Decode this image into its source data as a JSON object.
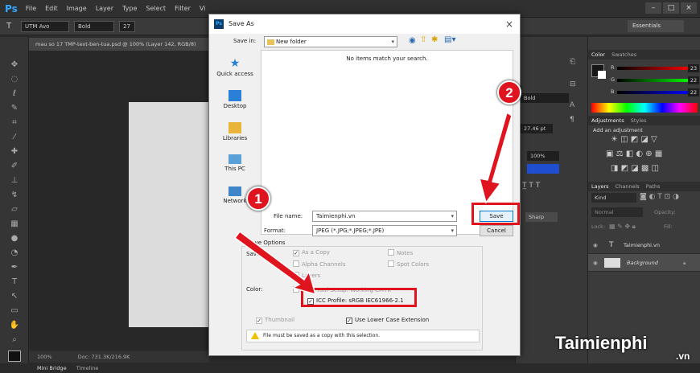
{
  "app": {
    "logo": "Ps",
    "menu": [
      "File",
      "Edit",
      "Image",
      "Layer",
      "Type",
      "Select",
      "Filter",
      "Vi"
    ]
  },
  "window_buttons": [
    "–",
    "□",
    "×"
  ],
  "options_bar": {
    "font_family": "UTM Avo",
    "font_style": "Bold",
    "size_prefix": "27"
  },
  "workspace": "Essentials",
  "document_tab": "mau so 17 TMP-text-ben-tua.psd @ 100% (Layer 142, RGB/8)",
  "status": {
    "zoom": "100%",
    "doc": "Doc: 731.3K/216.9K"
  },
  "bottom_tabs": [
    "Mini Bridge",
    "Timeline"
  ],
  "char_panel": {
    "style": "Bold",
    "size": "27.46 pt",
    "scale": "100%",
    "aa": "Sharp"
  },
  "color_panel": {
    "tabs": [
      "Color",
      "Swatches"
    ],
    "r": "23",
    "g": "22",
    "b": "22"
  },
  "adjustments": {
    "tabs": [
      "Adjustments",
      "Styles"
    ],
    "title": "Add an adjustment"
  },
  "layers": {
    "tabs": [
      "Layers",
      "Channels",
      "Paths"
    ],
    "kind": "Kind",
    "blend": "Normal",
    "opacity_label": "Opacity:",
    "lock_label": "Lock:",
    "fill_label": "Fill:",
    "rows": [
      {
        "name": "Taimienphi.vn"
      },
      {
        "name": "Background"
      }
    ]
  },
  "dialog": {
    "title": "Save As",
    "close": "×",
    "save_in_label": "Save in:",
    "save_in_value": "New folder",
    "empty_message": "No items match your search.",
    "places": [
      "Quick access",
      "Desktop",
      "Libraries",
      "This PC",
      "Network"
    ],
    "file_name_label": "File name:",
    "file_name_value": "Taimienphi.vn",
    "format_label": "Format:",
    "format_value": "JPEG (*.JPG;*.JPEG;*.JPE)",
    "save_button": "Save",
    "cancel_button": "Cancel",
    "save_options_label": "Save Options",
    "save_label": "Save:",
    "as_a_copy": "As a Copy",
    "notes": "Notes",
    "alpha_channels": "Alpha Channels",
    "spot_colors": "Spot Colors",
    "layers": "Layers",
    "color_label": "Color:",
    "use_proof": "Use Proof Setup: Working CMYK",
    "icc_profile": "ICC Profile:  sRGB IEC61966-2.1",
    "thumbnail": "Thumbnail",
    "lower_case": "Use Lower Case Extension",
    "warning": "File must be saved as a copy with this selection."
  },
  "annotations": {
    "badge1": "1",
    "badge2": "2"
  },
  "watermark": {
    "text": "Taimienphi",
    "suffix": ".vn"
  },
  "colors": {
    "accent_red": "#e0141e",
    "ps_blue": "#31a8ff"
  }
}
